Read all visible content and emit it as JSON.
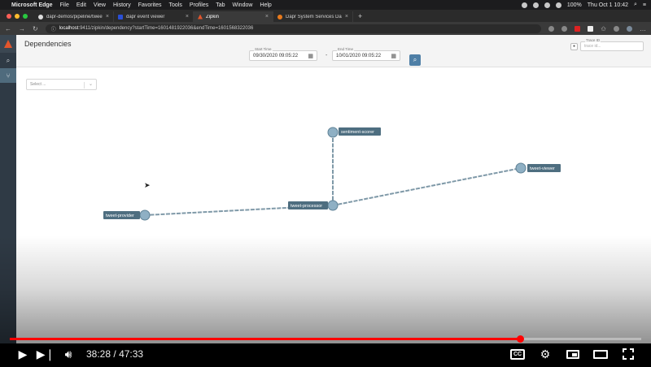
{
  "menubar": {
    "app_name": "Microsoft Edge",
    "menus": [
      "File",
      "Edit",
      "View",
      "History",
      "Favorites",
      "Tools",
      "Profiles",
      "Tab",
      "Window",
      "Help"
    ],
    "battery": "100%",
    "datetime": "Thu Oct 1  10:42"
  },
  "tabs": [
    {
      "label": "dapr-demos/pipeline/tweet-p",
      "favicon": "github-icon",
      "active": false
    },
    {
      "label": "dapr event viewer",
      "favicon": "dapr-icon",
      "active": false
    },
    {
      "label": "Zipkin",
      "favicon": "zipkin-icon",
      "active": true
    },
    {
      "label": "Dapr System Services Dashb",
      "favicon": "dapr-dashboard-icon",
      "active": false
    }
  ],
  "address": {
    "host": "localhost",
    "path": ":9411/zipkin/dependency?startTime=1601481922036&endTime=1601568322036"
  },
  "zipkin": {
    "page_title": "Dependencies",
    "start_time_label": "Start Time",
    "start_time": "09/30/2020 09:05:22",
    "end_time_label": "End Time",
    "end_time": "10/01/2020 09:05:22",
    "separator": "-",
    "trace_id_label": "Trace ID",
    "trace_id_placeholder": "trace id...",
    "select_placeholder": "Select ...",
    "services": [
      {
        "id": "sentiment-scorer",
        "label": "sentiment-scorer"
      },
      {
        "id": "tweet-viewer",
        "label": "tweet-viewer"
      },
      {
        "id": "tweet-provider",
        "label": "tweet-provider"
      },
      {
        "id": "tweet-processor",
        "label": "tweet-processor"
      }
    ],
    "edges": [
      {
        "from": "tweet-provider",
        "to": "tweet-processor"
      },
      {
        "from": "tweet-processor",
        "to": "sentiment-scorer"
      },
      {
        "from": "tweet-processor",
        "to": "tweet-viewer"
      }
    ]
  },
  "player": {
    "current_time": "38:28",
    "separator": "/",
    "duration": "47:33",
    "played_fraction": 0.809,
    "buffered_fraction": 0.812
  },
  "colors": {
    "node": "#8fb0c4",
    "label_bg": "#4e6e80",
    "edge": "#7f99a8",
    "accent": "#4f7fa6",
    "progress": "#ff0000"
  }
}
